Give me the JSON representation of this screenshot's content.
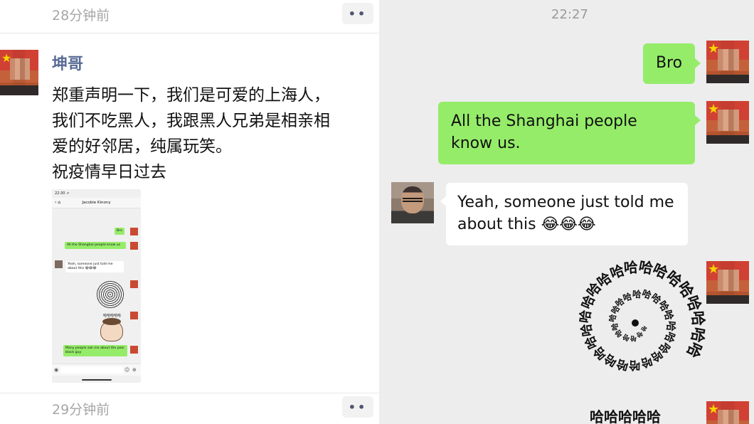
{
  "moments": {
    "top_timestamp": "28分钟前",
    "bottom_timestamp": "29分钟前",
    "more_glyph": "••",
    "author": "坤哥",
    "post_text": "郑重声明一下，我们是可爱的上海人，\n我们不吃黑人，我跟黑人兄弟是相亲相\n爱的好邻居，纯属玩笑。\n祝疫情早日过去",
    "embedded_screenshot": {
      "status_time": "22:30 ⇗",
      "chat_title": "Jacobie Kinony",
      "back_glyph": "‹ ⌂",
      "messages": [
        {
          "side": "right",
          "text": "Bro"
        },
        {
          "side": "right",
          "text": "All the Shanghai people know us"
        },
        {
          "side": "left",
          "text": "Yeah, someone just told me about this 😂😂😂"
        },
        {
          "side": "right",
          "text": "哈哈哈哈哈"
        },
        {
          "side": "right",
          "text": "Many people ask me about the poor black guy"
        }
      ]
    }
  },
  "chat": {
    "time": "22:27",
    "messages": [
      {
        "side": "right",
        "text": "Bro"
      },
      {
        "side": "right",
        "text": "All the Shanghai people know us."
      },
      {
        "side": "left",
        "text": "Yeah, someone just told me about this 😂😂😂"
      }
    ],
    "spiral_char": "哈",
    "ha_line": "哈哈哈哈哈"
  },
  "colors": {
    "wechat_green": "#95ec69",
    "author_blue": "#586b95",
    "chat_bg": "#ededed"
  },
  "icons": [
    "more-icon",
    "flag-star-icon",
    "laughing-emoji-icon",
    "emoji-icon",
    "add-icon",
    "voice-icon"
  ]
}
